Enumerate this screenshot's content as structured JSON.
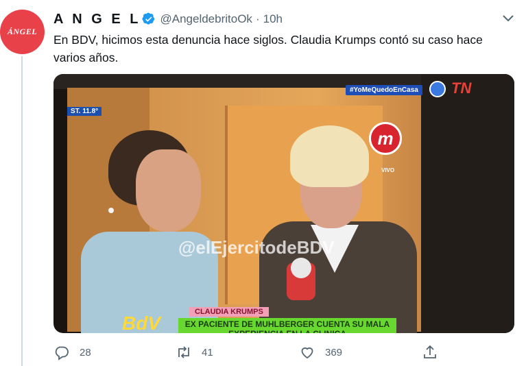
{
  "tweet": {
    "avatar_text": "ÁNGEL",
    "author_name": "A N G E L",
    "handle": "@AngeldebritoOk",
    "separator": "·",
    "time": "10h",
    "text": "En BDV, hicimos esta denuncia hace siglos. Claudia Krumps contó su caso hace varios años."
  },
  "media": {
    "temperature": "ST. 11.8°",
    "hashtag": "#YoMeQuedoEnCasa",
    "channel_logo": "TN",
    "m_logo": "m",
    "live": "VIVO",
    "watermark": "@elEjercitodeBDV",
    "lower_third_name": "CLAUDIA KRUMPS",
    "lower_third_caption": "EX PACIENTE DE MUHLBERGER CUENTA SU MALA EXPERIENCIA EN LA CLINICA",
    "show_logo": "BdV"
  },
  "actions": {
    "reply_count": "28",
    "retweet_count": "41",
    "like_count": "369"
  },
  "colors": {
    "verified": "#1d9bf0",
    "muted": "#536471",
    "avatar_bg": "#e8414a"
  }
}
